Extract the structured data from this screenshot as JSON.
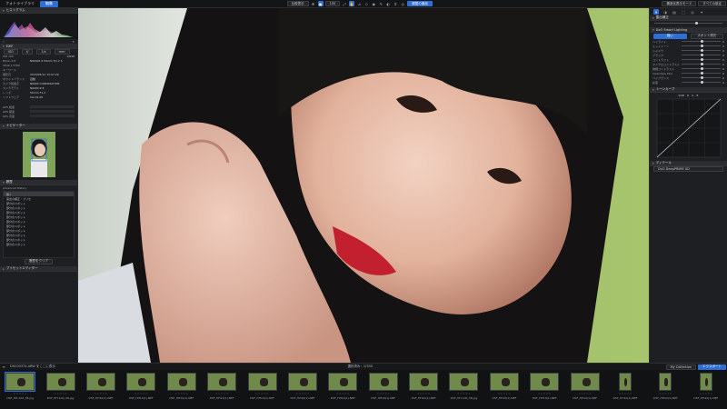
{
  "topbar": {
    "tabs": [
      "フォトライブラリ",
      "編集"
    ],
    "center_buttons": [
      "比較表示",
      "100",
      "調整の適用"
    ],
    "right_buttons": [
      "構造化表示モード",
      "すべての設定"
    ]
  },
  "left_panel": {
    "histogram_title": "ヒストグラム",
    "exif_title": "EXIF",
    "exif_rows": [
      {
        "k": "ISO 100",
        "v": "1/640"
      },
      {
        "k": "Nikon Z 8",
        "v": "NIKKOR Z 50mm f/1.2 S"
      },
      {
        "k": "3840 x 5760",
        "v": ""
      },
      {
        "k": "キーワード",
        "v": ""
      },
      {
        "k": "撮影日",
        "v": "2023/05/11 15:07:20"
      },
      {
        "k": "ホワイトバランス",
        "v": "自動"
      },
      {
        "k": "カメラ製造元",
        "v": "NIKON CORPORATION"
      },
      {
        "k": "カメラモデル",
        "v": "NIKON Z 8"
      },
      {
        "k": "レンズ",
        "v": "50mm F1.2"
      },
      {
        "k": "ソフトウェア",
        "v": "Ver.01.00"
      }
    ],
    "gps_rows": [
      "GPS 緯度",
      "GPS 経度",
      "GPS 高度"
    ],
    "nav_title": "ナビゲーター",
    "history_title": "履歴",
    "history_subtitle": "Advanced History",
    "history_items": [
      "開く",
      "露出の補正・プリセ",
      "部分のスポット",
      "部分のスポット",
      "部分のスポット",
      "部分のスポット",
      "部分のスポット",
      "部分のスポット",
      "部分のスポット",
      "部分のスポット",
      "部分のスポット",
      "部分のスポット"
    ],
    "history_footer": "履歴をクリア",
    "preset_title": "プリセットエディター"
  },
  "right_panel": {
    "top_title": "露出補正",
    "section_title": "DxO Smart Lighting",
    "btn_a": "強い",
    "btn_b": "スポット測光",
    "sliders": [
      {
        "k": "ハイライト",
        "v": "0"
      },
      {
        "k": "ミッドトーン",
        "v": "0"
      },
      {
        "k": "シャドウ",
        "v": "0"
      },
      {
        "k": "ブラック",
        "v": "0"
      },
      {
        "k": "コントラスト",
        "v": "0"
      },
      {
        "k": "マイクロコントラスト",
        "v": "0"
      },
      {
        "k": "微細コントラスト",
        "v": "0"
      },
      {
        "k": "ClearView Plus",
        "v": "0"
      },
      {
        "k": "バイブランス",
        "v": "0"
      },
      {
        "k": "彩度",
        "v": "0"
      }
    ],
    "tone_title": "トーンカーブ",
    "tone_tabs": [
      "RGB",
      "R",
      "G",
      "B"
    ],
    "bottom_title": "ディテール",
    "bottom_row": "DxO DeepPRIME XD"
  },
  "infobar": {
    "left_text": "DSC00374.ARW をここに表示",
    "center_text": "選択済み：1/350",
    "right_buttons": [
      "My Collection",
      "エクスポート"
    ]
  },
  "filmstrip": {
    "items": [
      {
        "name": "DSF_HH-100_38.jpg",
        "portrait": false
      },
      {
        "name": "DSF_HH-100_38.jpg",
        "portrait": false
      },
      {
        "name": "DSF_HH10(1).NEF",
        "portrait": false
      },
      {
        "name": "DSF_HH10(1).NEF",
        "portrait": false
      },
      {
        "name": "DSF_HH10(1).NEF",
        "portrait": false
      },
      {
        "name": "DSF_HH10(1).NEF",
        "portrait": false
      },
      {
        "name": "DSF_HH10(1).NEF",
        "portrait": false
      },
      {
        "name": "DSF_HH10(1).NEF",
        "portrait": false
      },
      {
        "name": "DSF_HH10(1).NEF",
        "portrait": false
      },
      {
        "name": "DSF_HH10(1).NEF",
        "portrait": false
      },
      {
        "name": "DSF_HH10(1).NEF",
        "portrait": false
      },
      {
        "name": "DSF_HH-100_38.jpg",
        "portrait": false
      },
      {
        "name": "DSF_HH10(1).NEF",
        "portrait": false
      },
      {
        "name": "DSF_HH10(1).NEF",
        "portrait": false
      },
      {
        "name": "DSF_HH10(1).NEF",
        "portrait": false
      },
      {
        "name": "DSF_HH10(1).NEF",
        "portrait": true
      },
      {
        "name": "DSF_HH10(1).NEF",
        "portrait": true
      },
      {
        "name": "DSF_HH10(1).NEF",
        "portrait": true
      }
    ]
  },
  "colors": {
    "accent": "#2d6fd6"
  }
}
